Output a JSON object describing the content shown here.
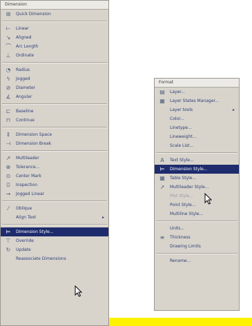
{
  "dimension_menu": {
    "title": "Dimension",
    "groups": [
      [
        {
          "label": "Quick Dimension",
          "icon": "quick-dimension"
        }
      ],
      [
        {
          "label": "Linear",
          "icon": "linear-dim"
        },
        {
          "label": "Aligned",
          "icon": "aligned-dim"
        },
        {
          "label": "Arc Length",
          "icon": "arc-length-dim"
        },
        {
          "label": "Ordinate",
          "icon": "ordinate-dim"
        }
      ],
      [
        {
          "label": "Radius",
          "icon": "radius-dim"
        },
        {
          "label": "Jogged",
          "icon": "jogged-dim"
        },
        {
          "label": "Diameter",
          "icon": "diameter-dim"
        },
        {
          "label": "Angular",
          "icon": "angular-dim"
        }
      ],
      [
        {
          "label": "Baseline",
          "icon": "baseline-dim"
        },
        {
          "label": "Continue",
          "icon": "continue-dim"
        }
      ],
      [
        {
          "label": "Dimension Space",
          "icon": "dimension-space"
        },
        {
          "label": "Dimension Break",
          "icon": "dimension-break"
        }
      ],
      [
        {
          "label": "Multileader",
          "icon": "multileader"
        },
        {
          "label": "Tolerance...",
          "icon": "tolerance"
        },
        {
          "label": "Center Mark",
          "icon": "center-mark"
        },
        {
          "label": "Inspection",
          "icon": "inspection"
        },
        {
          "label": "Jogged Linear",
          "icon": "jogged-linear"
        }
      ],
      [
        {
          "label": "Oblique",
          "icon": "oblique"
        },
        {
          "label": "Align Text",
          "icon": "",
          "submenu": true
        }
      ],
      [
        {
          "label": "Dimension Style...",
          "icon": "dimension-style",
          "selected": true
        },
        {
          "label": "Override",
          "icon": "override"
        },
        {
          "label": "Update",
          "icon": "update"
        },
        {
          "label": "Reassociate Dimensions",
          "icon": ""
        }
      ]
    ]
  },
  "format_menu": {
    "title": "Format",
    "groups": [
      [
        {
          "label": "Layer...",
          "icon": "layer"
        },
        {
          "label": "Layer States Manager...",
          "icon": "layer-states"
        },
        {
          "label": "Layer tools",
          "icon": "",
          "submenu": true
        },
        {
          "label": "Color...",
          "icon": ""
        },
        {
          "label": "Linetype...",
          "icon": ""
        },
        {
          "label": "Lineweight...",
          "icon": ""
        },
        {
          "label": "Scale List...",
          "icon": ""
        }
      ],
      [
        {
          "label": "Text Style...",
          "icon": "text-style"
        },
        {
          "label": "Dimension Style...",
          "icon": "dimension-style",
          "selected": true
        },
        {
          "label": "Table Style...",
          "icon": "table-style"
        },
        {
          "label": "Multileader Style...",
          "icon": "multileader-style"
        },
        {
          "label": "Plot Style...",
          "icon": "",
          "disabled": true
        },
        {
          "label": "Point Style...",
          "icon": ""
        },
        {
          "label": "Multiline Style...",
          "icon": ""
        }
      ],
      [
        {
          "label": "Units...",
          "icon": ""
        },
        {
          "label": "Thickness",
          "icon": "thickness"
        },
        {
          "label": "Drawing Limits",
          "icon": ""
        }
      ],
      [
        {
          "label": "Rename...",
          "icon": ""
        }
      ]
    ]
  },
  "icons": {
    "quick-dimension": "⊞",
    "linear-dim": "⊢",
    "aligned-dim": "↘",
    "arc-length-dim": "⌒",
    "ordinate-dim": "⊥",
    "radius-dim": "◔",
    "jogged-dim": "ϟ",
    "diameter-dim": "⊘",
    "angular-dim": "∡",
    "baseline-dim": "⊏",
    "continue-dim": "⊓",
    "dimension-space": "⇕",
    "dimension-break": "⊣",
    "multileader": "↗",
    "tolerance": "⊕",
    "center-mark": "⊙",
    "inspection": "⌼",
    "jogged-linear": "⇝",
    "oblique": "⁄",
    "dimension-style": "⊨",
    "override": "⊤",
    "update": "↻",
    "layer": "▤",
    "layer-states": "▦",
    "text-style": "A",
    "table-style": "▦",
    "multileader-style": "↗",
    "thickness": "≡"
  },
  "colors": {
    "menu_bg": "#d8d4cc",
    "selected_bg": "#1e2c6e",
    "highlight_bar": "#fff200"
  }
}
